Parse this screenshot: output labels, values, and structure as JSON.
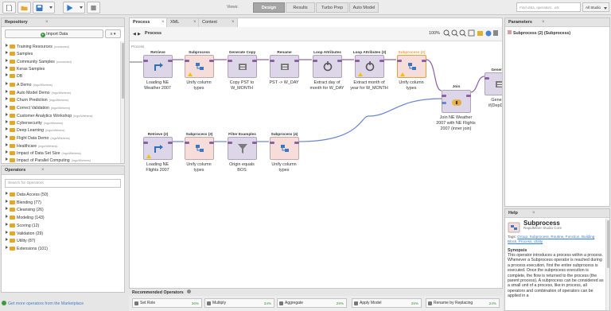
{
  "toolbar": {
    "views_label": "Views:",
    "views": [
      "Design",
      "Results",
      "Turbo Prep",
      "Auto Model"
    ],
    "active_view": "Design",
    "search_placeholder": "Find data, operators...etc",
    "studio_label": "All Studio"
  },
  "repository": {
    "title": "Repository",
    "import_label": "Import Data",
    "items": [
      {
        "label": "Training Resources",
        "sub": "(connected)",
        "folder": true
      },
      {
        "label": "Samples",
        "sub": "",
        "folder": true
      },
      {
        "label": "Community Samples",
        "sub": "(connected)",
        "folder": true
      },
      {
        "label": "Keras Samples",
        "sub": "",
        "folder": true
      },
      {
        "label": "DB",
        "sub": "",
        "folder": true
      },
      {
        "label": "A Demo",
        "sub": "(Ingo/Wiehens)",
        "folder": true
      },
      {
        "label": "Auto Model Demo",
        "sub": "(Ingo/Wiehens)",
        "folder": true
      },
      {
        "label": "Churn Prediction",
        "sub": "(Ingo/Wiehens)",
        "folder": true
      },
      {
        "label": "Correct Validation",
        "sub": "(Ingo/Wiehens)",
        "folder": true
      },
      {
        "label": "Customer Analytics Workshop",
        "sub": "(Ingo/Wiehens)",
        "folder": true
      },
      {
        "label": "Cybersecurity",
        "sub": "(Ingo/Wiehens)",
        "folder": true
      },
      {
        "label": "Deep Learning",
        "sub": "(Ingo/Wiehens)",
        "folder": true
      },
      {
        "label": "Flight Data Demo",
        "sub": "(Ingo/Wiehens)",
        "folder": true
      },
      {
        "label": "Healthcare",
        "sub": "(Ingo/Wiehens)",
        "folder": true
      },
      {
        "label": "Impact of Data Set Size",
        "sub": "(Ingo/Wiehens)",
        "folder": true
      },
      {
        "label": "Impact of Parallel Computing",
        "sub": "(Ingo/Wiehens)",
        "folder": true
      }
    ]
  },
  "operators": {
    "title": "Operators",
    "search_placeholder": "Search for Operators",
    "items": [
      "Data Access (50)",
      "Blending (77)",
      "Cleansing (26)",
      "Modeling (143)",
      "Scoring (12)",
      "Validation (29)",
      "Utility (87)",
      "Extensions (101)"
    ],
    "marketplace_link": "Get more operators from the Marketplace"
  },
  "process": {
    "tabs": [
      "Process",
      "XML",
      "Context"
    ],
    "breadcrumb": "Process",
    "zoom": "100%",
    "canvas_label": "Process",
    "operators": [
      {
        "name": "Retrieve",
        "label": "Loading NE Weather 2007",
        "type": "retrieve"
      },
      {
        "name": "Subprocess",
        "label": "Unify column types",
        "type": "subprocess"
      },
      {
        "name": "Generate Copy",
        "label": "Copy PST to W_MONTH",
        "type": "generic"
      },
      {
        "name": "Rename",
        "label": "PST -> W_DAY",
        "type": "generic"
      },
      {
        "name": "Loop Attributes",
        "label": "Extract day of month for W_DAY",
        "type": "loop"
      },
      {
        "name": "Loop Attributes (2)",
        "label": "Extract month of year for W_MONTH",
        "type": "loop"
      },
      {
        "name": "Subprocess (2)",
        "label": "Unify column types",
        "type": "subprocess"
      },
      {
        "name": "Join",
        "label": "Join NE Weather 2007 with NE Flights 2007 (inner join)",
        "type": "join"
      },
      {
        "name": "Generate",
        "label": "Gener... if(DepDe...",
        "type": "generic"
      },
      {
        "name": "Retrieve (2)",
        "label": "Loading NE Flights 2007",
        "type": "retrieve"
      },
      {
        "name": "Subprocess (3)",
        "label": "Unify column types",
        "type": "subprocess"
      },
      {
        "name": "Filter Examples",
        "label": "Origin equals BOS",
        "type": "filter"
      },
      {
        "name": "Subprocess (4)",
        "label": "Unify column types",
        "type": "subprocess"
      }
    ]
  },
  "recommended": {
    "title": "Recommended Operators",
    "items": [
      {
        "label": "Set Role",
        "pct": "36%"
      },
      {
        "label": "Multiply",
        "pct": "34%"
      },
      {
        "label": "Aggregate",
        "pct": "29%"
      },
      {
        "label": "Apply Model",
        "pct": "25%"
      },
      {
        "label": "Rename by Replacing",
        "pct": "24%"
      }
    ]
  },
  "parameters": {
    "title": "Parameters",
    "context": "Subprocess (2) (Subprocess)"
  },
  "help": {
    "title": "Help",
    "op_title": "Subprocess",
    "op_sub": "RapidMiner Studio Core",
    "tags_label": "Tags:",
    "tags": "Group, Subprocess, Routine, Function, Building Block, Process, Utility",
    "synopsis_title": "Synopsis",
    "synopsis": "This operator introduces a process within a process. Whenever a Subprocess operator is reached during a process execution, first the entire subprocess is executed. Once the subprocess execution is complete, the flow is returned to the process (the parent process). A subprocess can be considered as a small unit of a process, like in process, all operators and combination of operators can be applied in a"
  },
  "colors": {
    "accent": "#3d7fc7",
    "op_default": "#ddd6e8",
    "op_process": "#f6ddda",
    "connection_purple": "#8b61a5",
    "connection_blue": "#6c86d4",
    "selected_orange": "#f39c3d"
  }
}
